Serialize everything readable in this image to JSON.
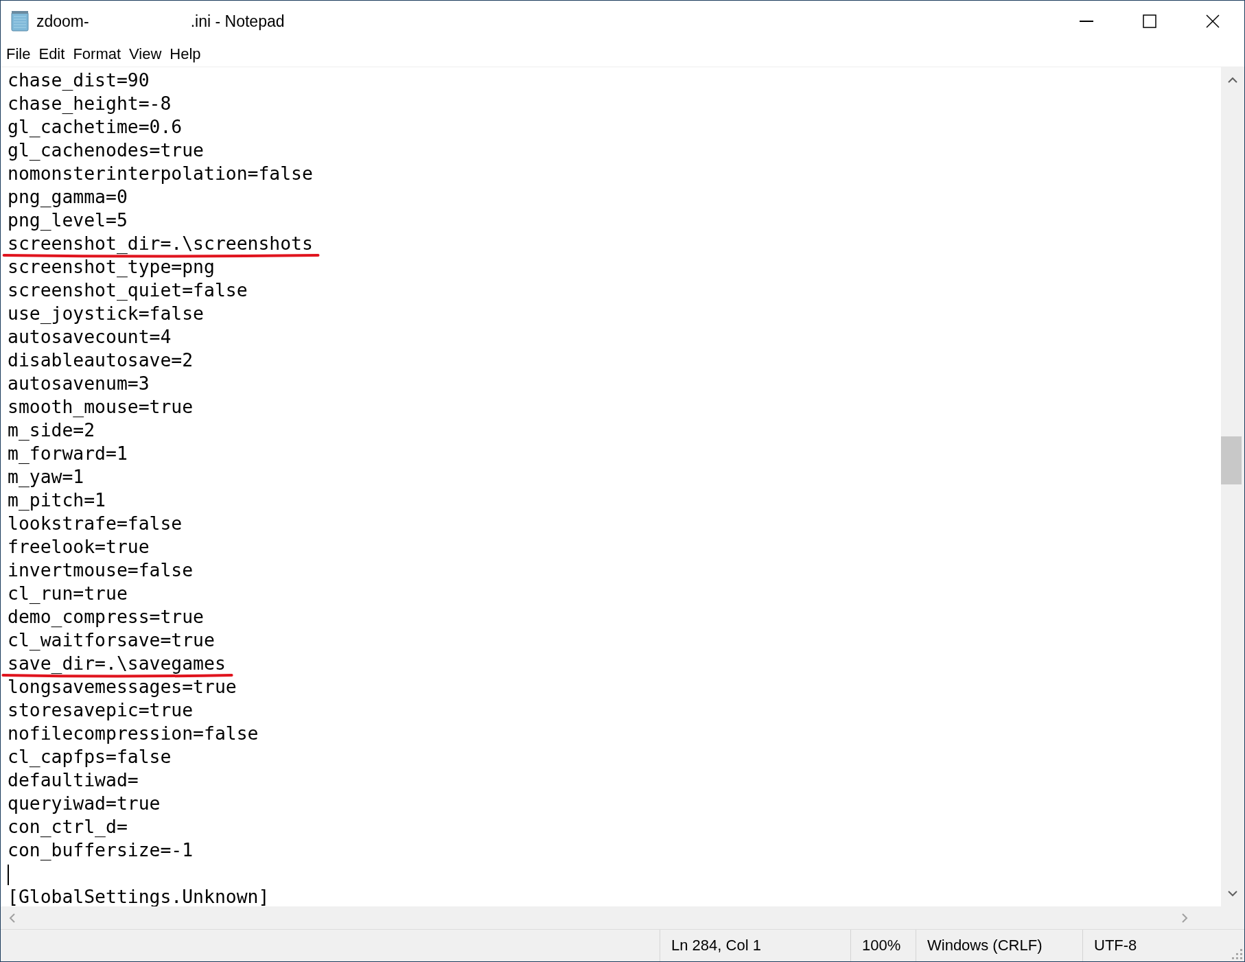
{
  "window": {
    "title_parts": [
      "zdoom-",
      ".ini - Notepad"
    ]
  },
  "menu": [
    "File",
    "Edit",
    "Format",
    "View",
    "Help"
  ],
  "lines": [
    {
      "kind": "text",
      "text": "chase_dist=90",
      "underlined": false
    },
    {
      "kind": "text",
      "text": "chase_height=-8",
      "underlined": false
    },
    {
      "kind": "text",
      "text": "gl_cachetime=0.6",
      "underlined": false
    },
    {
      "kind": "text",
      "text": "gl_cachenodes=true",
      "underlined": false
    },
    {
      "kind": "text",
      "text": "nomonsterinterpolation=false",
      "underlined": false
    },
    {
      "kind": "text",
      "text": "png_gamma=0",
      "underlined": false
    },
    {
      "kind": "text",
      "text": "png_level=5",
      "underlined": false
    },
    {
      "kind": "text",
      "text": "screenshot_dir=.\\screenshots",
      "underlined": true
    },
    {
      "kind": "text",
      "text": "screenshot_type=png",
      "underlined": false
    },
    {
      "kind": "text",
      "text": "screenshot_quiet=false",
      "underlined": false
    },
    {
      "kind": "text",
      "text": "use_joystick=false",
      "underlined": false
    },
    {
      "kind": "text",
      "text": "autosavecount=4",
      "underlined": false
    },
    {
      "kind": "text",
      "text": "disableautosave=2",
      "underlined": false
    },
    {
      "kind": "text",
      "text": "autosavenum=3",
      "underlined": false
    },
    {
      "kind": "text",
      "text": "smooth_mouse=true",
      "underlined": false
    },
    {
      "kind": "text",
      "text": "m_side=2",
      "underlined": false
    },
    {
      "kind": "text",
      "text": "m_forward=1",
      "underlined": false
    },
    {
      "kind": "text",
      "text": "m_yaw=1",
      "underlined": false
    },
    {
      "kind": "text",
      "text": "m_pitch=1",
      "underlined": false
    },
    {
      "kind": "text",
      "text": "lookstrafe=false",
      "underlined": false
    },
    {
      "kind": "text",
      "text": "freelook=true",
      "underlined": false
    },
    {
      "kind": "text",
      "text": "invertmouse=false",
      "underlined": false
    },
    {
      "kind": "text",
      "text": "cl_run=true",
      "underlined": false
    },
    {
      "kind": "text",
      "text": "demo_compress=true",
      "underlined": false
    },
    {
      "kind": "text",
      "text": "cl_waitforsave=true",
      "underlined": false
    },
    {
      "kind": "text",
      "text": "save_dir=.\\savegames",
      "underlined": true
    },
    {
      "kind": "text",
      "text": "longsavemessages=true",
      "underlined": false
    },
    {
      "kind": "text",
      "text": "storesavepic=true",
      "underlined": false
    },
    {
      "kind": "text",
      "text": "nofilecompression=false",
      "underlined": false
    },
    {
      "kind": "text",
      "text": "cl_capfps=false",
      "underlined": false
    },
    {
      "kind": "text",
      "text": "defaultiwad=",
      "underlined": false
    },
    {
      "kind": "text",
      "text": "queryiwad=true",
      "underlined": false
    },
    {
      "kind": "text",
      "text": "con_ctrl_d=",
      "underlined": false
    },
    {
      "kind": "text",
      "text": "con_buffersize=-1",
      "underlined": false
    },
    {
      "kind": "caret"
    },
    {
      "kind": "text",
      "text": "[GlobalSettings.Unknown]",
      "underlined": false
    }
  ],
  "status_bar": [
    "Ln 284, Col 1",
    "100%",
    "Windows (CRLF)",
    "UTF-8"
  ]
}
